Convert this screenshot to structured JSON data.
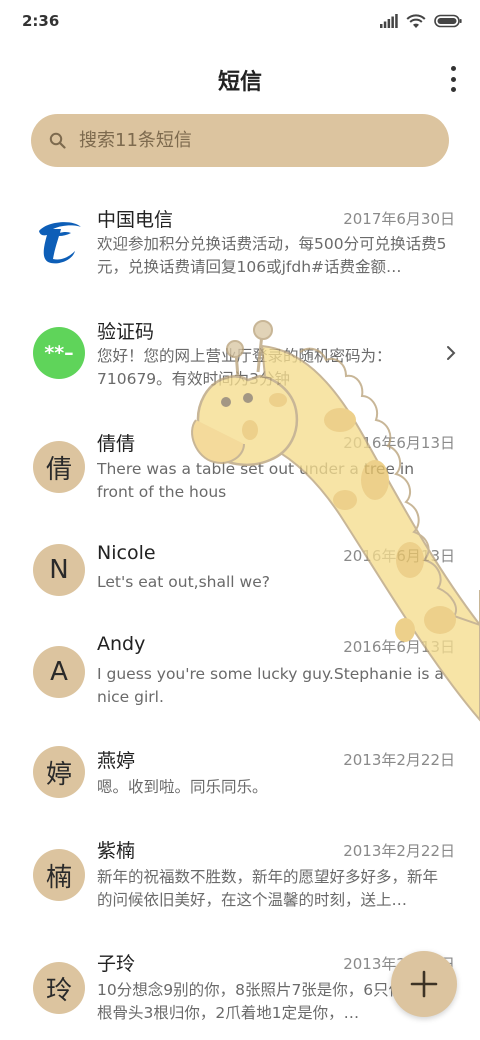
{
  "status": {
    "time": "2:36"
  },
  "header": {
    "title": "短信"
  },
  "search": {
    "placeholder": "搜索11条短信"
  },
  "threads": [
    {
      "name": "中国电信",
      "date": "2017年6月30日",
      "preview": "欢迎参加积分兑换话费活动，每500分可兑换话费5元，兑换话费请回复106或jfdh#话费金额…",
      "avatar_type": "logo",
      "avatar_icon": "china-telecom-logo"
    },
    {
      "name": "验证码",
      "date": "",
      "preview": "您好！您的网上营业厅登录的随机密码为：710679。有效时间为3分钟",
      "avatar_type": "badge",
      "avatar_text": "**–",
      "avatar_color": "#5fd45a"
    },
    {
      "name": "倩倩",
      "date": "2016年6月13日",
      "preview": "There was a table set out under a tree in front of the hous",
      "avatar_text": "倩"
    },
    {
      "name": "Nicole",
      "date": "2016年6月13日",
      "preview": "Let's eat out,shall we?",
      "avatar_text": "N"
    },
    {
      "name": "Andy",
      "date": "2016年6月13日",
      "preview": "I guess you're some lucky guy.Stephanie is a nice girl.",
      "avatar_text": "A"
    },
    {
      "name": "燕婷",
      "date": "2013年2月22日",
      "preview": "嗯。收到啦。同乐同乐。",
      "avatar_text": "婷"
    },
    {
      "name": "紫楠",
      "date": "2013年2月22日",
      "preview": "新年的祝福数不胜数，新年的愿望好多好多，新年的问候依旧美好，在这个温馨的时刻，送上…",
      "avatar_text": "楠"
    },
    {
      "name": "子玲",
      "date": "2013年2月22日",
      "preview": "10分想念9别的你，8张照片7张是你，6只像你，4根骨头3根归你，2爪着地1定是你，…",
      "avatar_text": "玲"
    }
  ],
  "colors": {
    "accent": "#dcc49f",
    "badge_green": "#5fd45a",
    "telecom_blue": "#0d5eb7"
  },
  "fab": {
    "icon": "plus-icon"
  }
}
